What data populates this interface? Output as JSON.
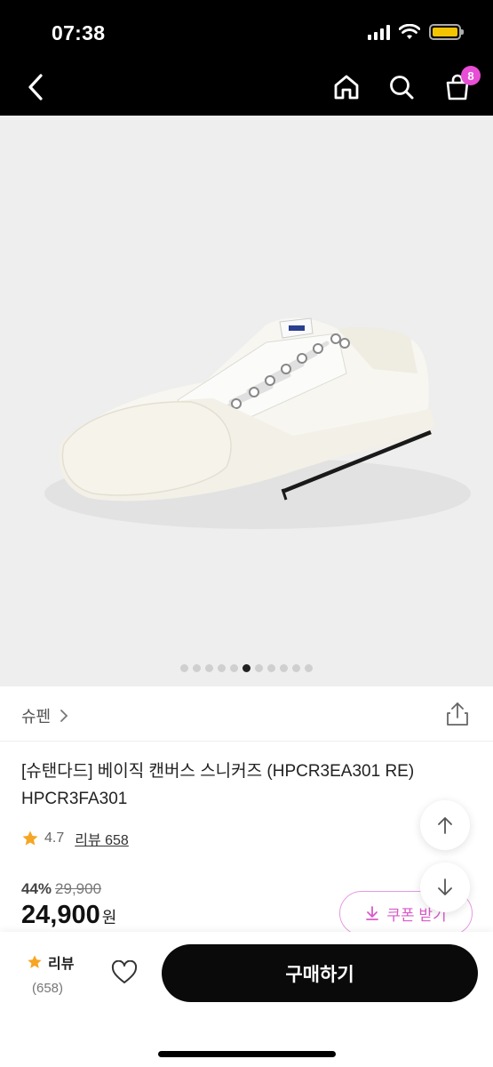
{
  "status_bar": {
    "time": "07:38"
  },
  "nav": {
    "icons": [
      "chevron-left-icon",
      "home-icon",
      "search-icon",
      "shopping-bag-icon"
    ],
    "cart_count": "8"
  },
  "gallery": {
    "image_count": 11,
    "active_index": 5
  },
  "brand": {
    "name": "슈펜"
  },
  "product": {
    "title": "[슈탠다드] 베이직 캔버스 스니커즈 (HPCR3EA301 RE) HPCR3FA301",
    "rating": "4.7",
    "review_link": "리뷰 658"
  },
  "price": {
    "discount": "44%",
    "original": "29,900",
    "sale": "24,900",
    "currency": "원"
  },
  "coupon": {
    "label": "쿠폰 받기"
  },
  "bottom_bar": {
    "review_label": "리뷰",
    "review_count": "(658)",
    "buy_label": "구매하기"
  },
  "colors": {
    "accent_pink": "#e84dd6",
    "star": "#f5a623",
    "buy_button": "#0a0a0a"
  }
}
